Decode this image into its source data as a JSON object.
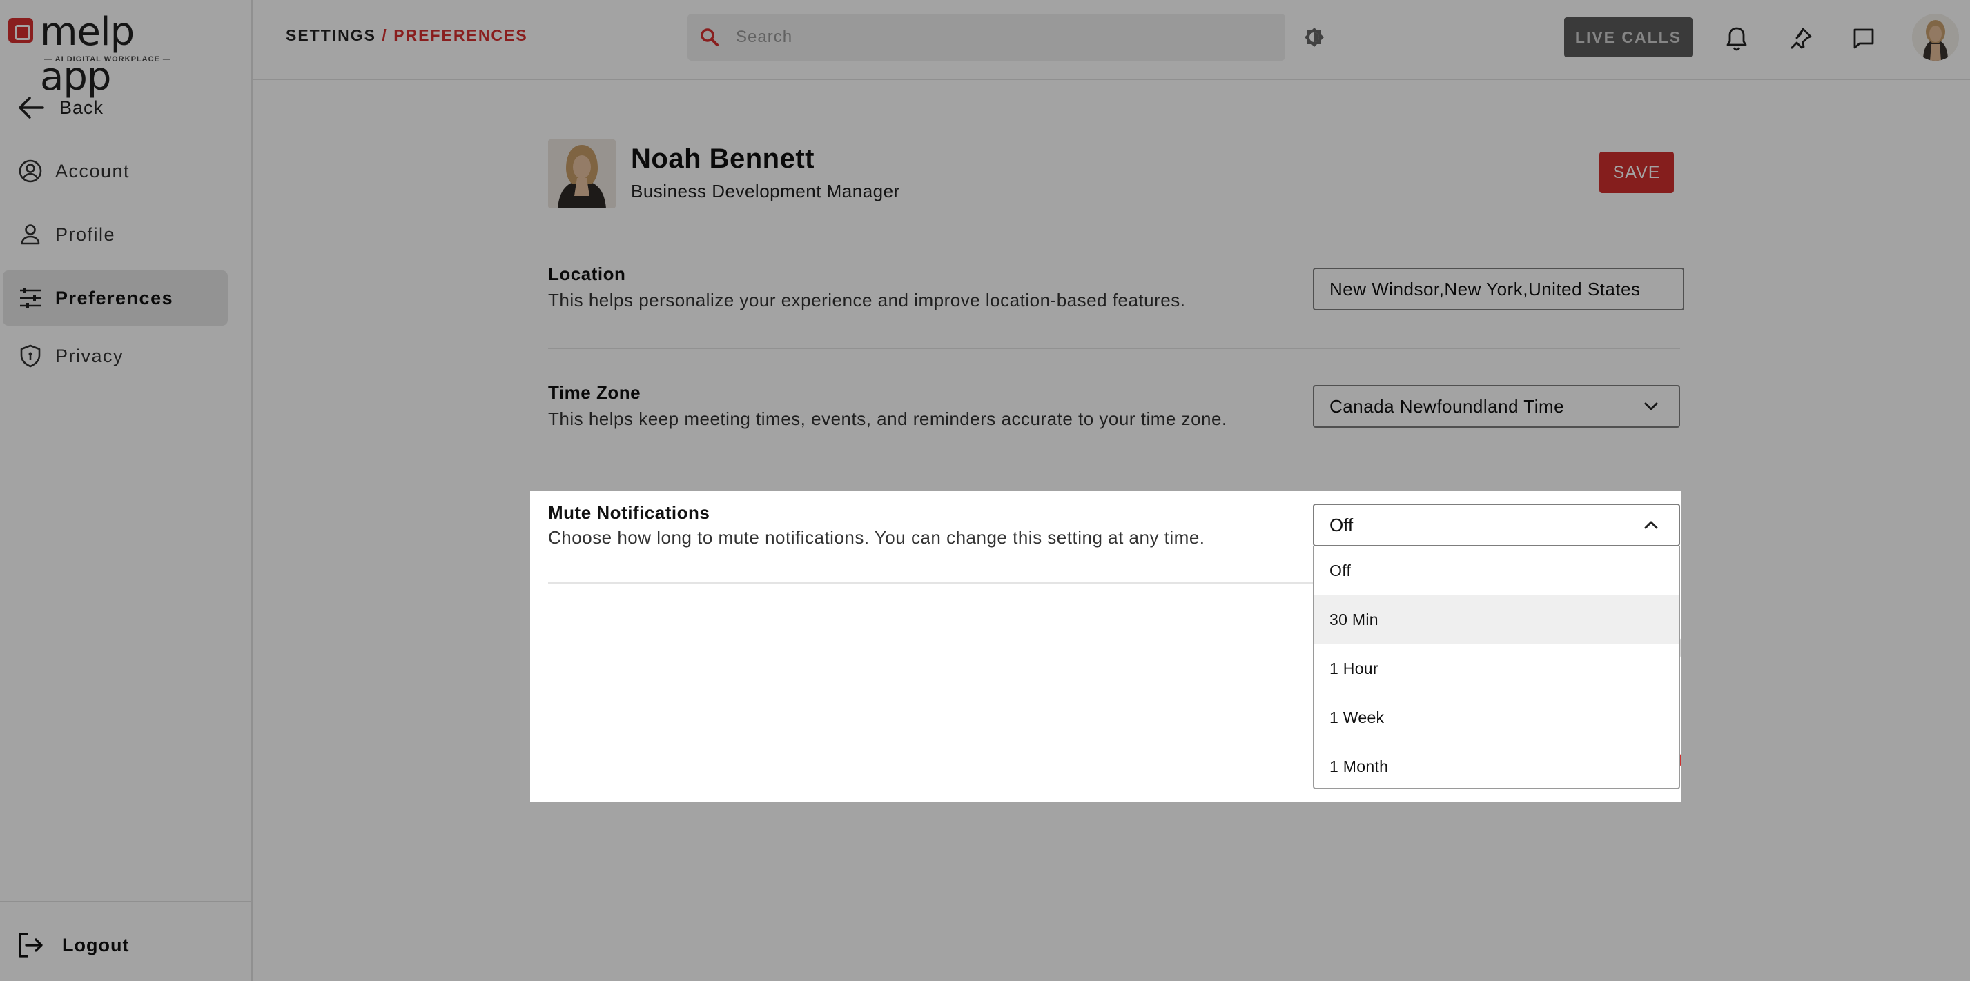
{
  "brand": {
    "name": "melp app",
    "tagline": "— AI DIGITAL WORKPLACE —",
    "accent": "#d6302f"
  },
  "sidebar": {
    "back_label": "Back",
    "items": [
      {
        "label": "Account",
        "icon": "user-circle-icon"
      },
      {
        "label": "Profile",
        "icon": "user-icon"
      },
      {
        "label": "Preferences",
        "icon": "sliders-icon",
        "active": true
      },
      {
        "label": "Privacy",
        "icon": "shield-icon"
      }
    ],
    "logout_label": "Logout"
  },
  "header": {
    "breadcrumb": {
      "root": "SETTINGS",
      "separator": "/",
      "current": "PREFERENCES"
    },
    "search_placeholder": "Search",
    "live_calls_label": "LIVE CALLS",
    "icons": [
      "theme-icon",
      "bell-icon",
      "pin-icon",
      "chat-icon"
    ]
  },
  "profile": {
    "name": "Noah Bennett",
    "title": "Business Development Manager",
    "save_label": "SAVE"
  },
  "settings": {
    "location": {
      "title": "Location",
      "description": "This helps personalize your experience and improve location-based features.",
      "value": "New Windsor,New York,United States"
    },
    "timezone": {
      "title": "Time Zone",
      "description": "This helps keep meeting times, events, and reminders accurate to your time zone.",
      "value": "Canada Newfoundland Time"
    },
    "mute": {
      "title": "Mute Notifications",
      "description": "Choose how long to mute notifications. You can change this setting at any time.",
      "value": "Off",
      "options": [
        "Off",
        "30 Min",
        "1 Hour",
        "1 Week",
        "1 Month"
      ],
      "hovered_option": "30 Min",
      "open": true
    }
  }
}
